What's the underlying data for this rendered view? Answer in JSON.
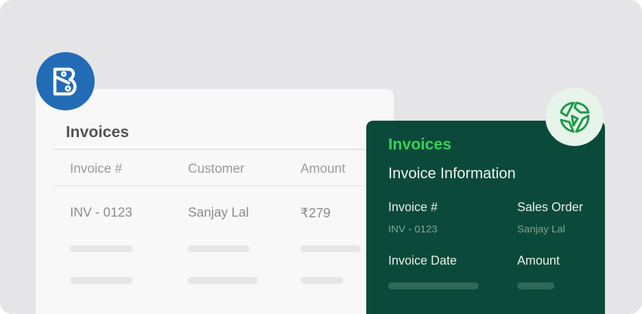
{
  "left_card": {
    "title": "Invoices",
    "columns": [
      "Invoice #",
      "Customer",
      "Amount"
    ],
    "row": {
      "invoice_no": "INV - 0123",
      "customer": "Sanjay Lal",
      "amount": "₹279"
    }
  },
  "right_card": {
    "title": "Invoices",
    "subtitle": "Invoice Information",
    "fields": [
      {
        "label": "Invoice #",
        "value": "INV - 0123"
      },
      {
        "label": "Sales Order",
        "value": "Sanjay Lal"
      },
      {
        "label": "Invoice Date",
        "value": ""
      },
      {
        "label": "Amount",
        "value": ""
      }
    ]
  },
  "icons": {
    "left_badge": "books-logo-icon",
    "right_badge": "integration-logo-icon"
  },
  "colors": {
    "background": "#e5e4e6",
    "left_badge": "#226cb6",
    "right_card": "#0b4a3a",
    "right_title": "#37d157",
    "right_badge": "#e6f4e9"
  }
}
